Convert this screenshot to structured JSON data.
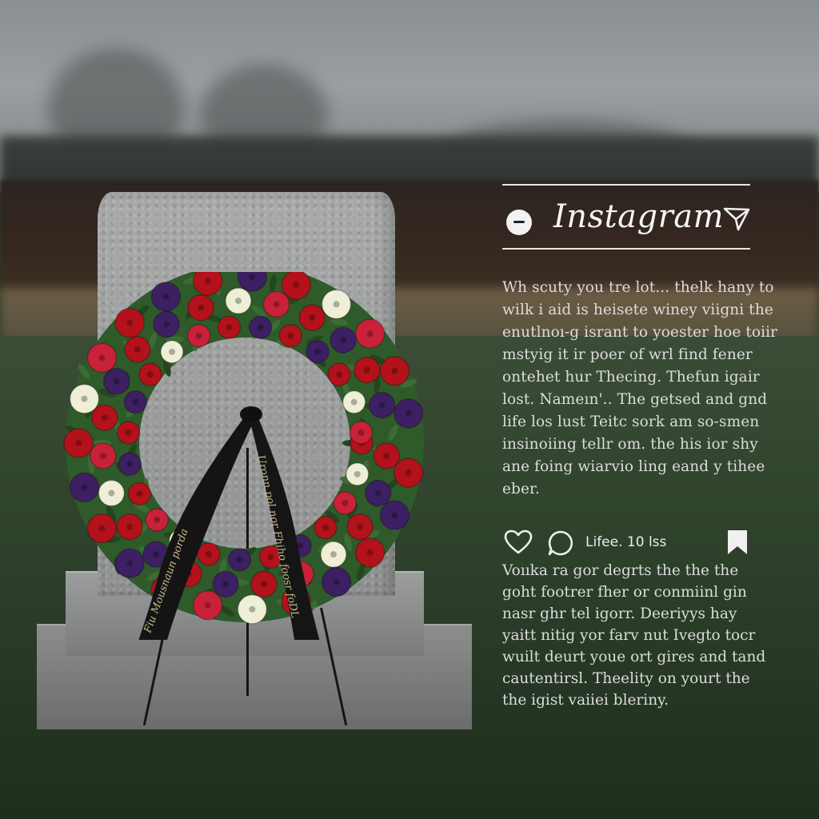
{
  "post": {
    "app_name": "Instagram",
    "caption_lines": [
      "Wh scuty you tre lot... thelk hany to",
      "wilk i aid is heisete winey viigni the",
      "enutlnoı-g isrant to yoester hoe toiir",
      "mstyig it ir poer of wrl find fener",
      "ontehet hur Thecing. Thefun igair",
      "lost. Nameın'.. The getsed and gnd",
      "life los lust Teitc sork am so-smen",
      "insinoiing tellr om. the his ior shy",
      "ane foing wiarvio ling eand y tihee",
      "eber."
    ],
    "likes_text": "Lifee. 10 lss",
    "comment_lines": [
      "Voııka ra gor degrts the the the",
      "goht footrer fher or conmiinl gin",
      "nasr ghr tel igorr. Deeriyys hay",
      "yaitt nitig yor farv nut Ivegto tocr",
      "wuilt deurt youe ort gires and tand",
      "cautentirsl. Theelity on yourt the",
      "the igist vaiiei bleriny."
    ]
  },
  "ribbon": {
    "left_text": "Fiu Mousnaun porda",
    "right_text": "Uronn pol nor Fhiho foosr foDL"
  },
  "colors": {
    "panel_text": "#dcdcdc",
    "rule": "#e6e6e6",
    "ribbon": "#141414",
    "flower_red": "#b3121b",
    "flower_purple": "#3d1f63",
    "flower_cream": "#efeed6",
    "foliage": "#2f5a2a"
  },
  "icons": [
    "chat-icon",
    "send-icon",
    "heart-icon",
    "comment-icon",
    "bookmark-icon"
  ]
}
